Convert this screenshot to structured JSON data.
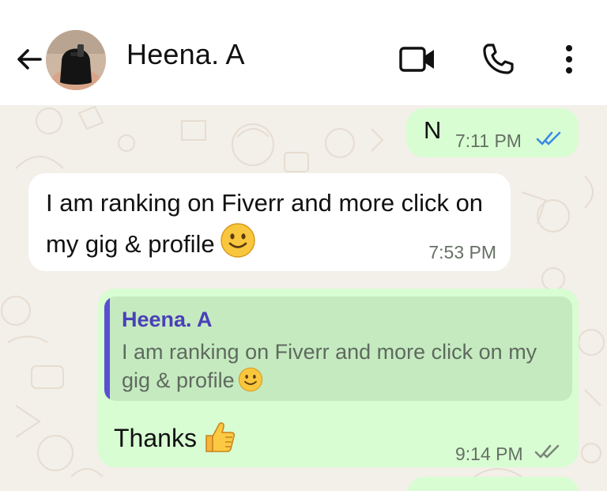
{
  "header": {
    "contact_name": "Heena. A",
    "icons": [
      "back-arrow-icon",
      "avatar",
      "video-call-icon",
      "voice-call-icon",
      "more-options-icon"
    ]
  },
  "messages": [
    {
      "direction": "outgoing",
      "text": "N",
      "time": "7:11 PM",
      "status": "read"
    },
    {
      "direction": "incoming",
      "text": "I am ranking on Fiverr and more click on my gig & profile",
      "emoji": "slightly-smiling-face",
      "time": "7:53 PM"
    },
    {
      "direction": "outgoing",
      "reply_to": {
        "name": "Heena. A",
        "text": "I am ranking on Fiverr and more click on my gig & profile",
        "emoji": "slightly-smiling-face"
      },
      "text": "Thanks",
      "emoji": "thumbs-up",
      "time": "9:14 PM",
      "status": "delivered"
    }
  ],
  "colors": {
    "header_bg": "#ffffff",
    "chat_bg": "#f3efe9",
    "outgoing_bubble": "#d8fdd2",
    "incoming_bubble": "#ffffff",
    "quote_bg": "#c5eac0",
    "quote_bar": "#5a4fd1",
    "quote_name": "#4a3fb8",
    "read_ticks": "#3a8ae6",
    "delivered_ticks": "#7d857c"
  }
}
